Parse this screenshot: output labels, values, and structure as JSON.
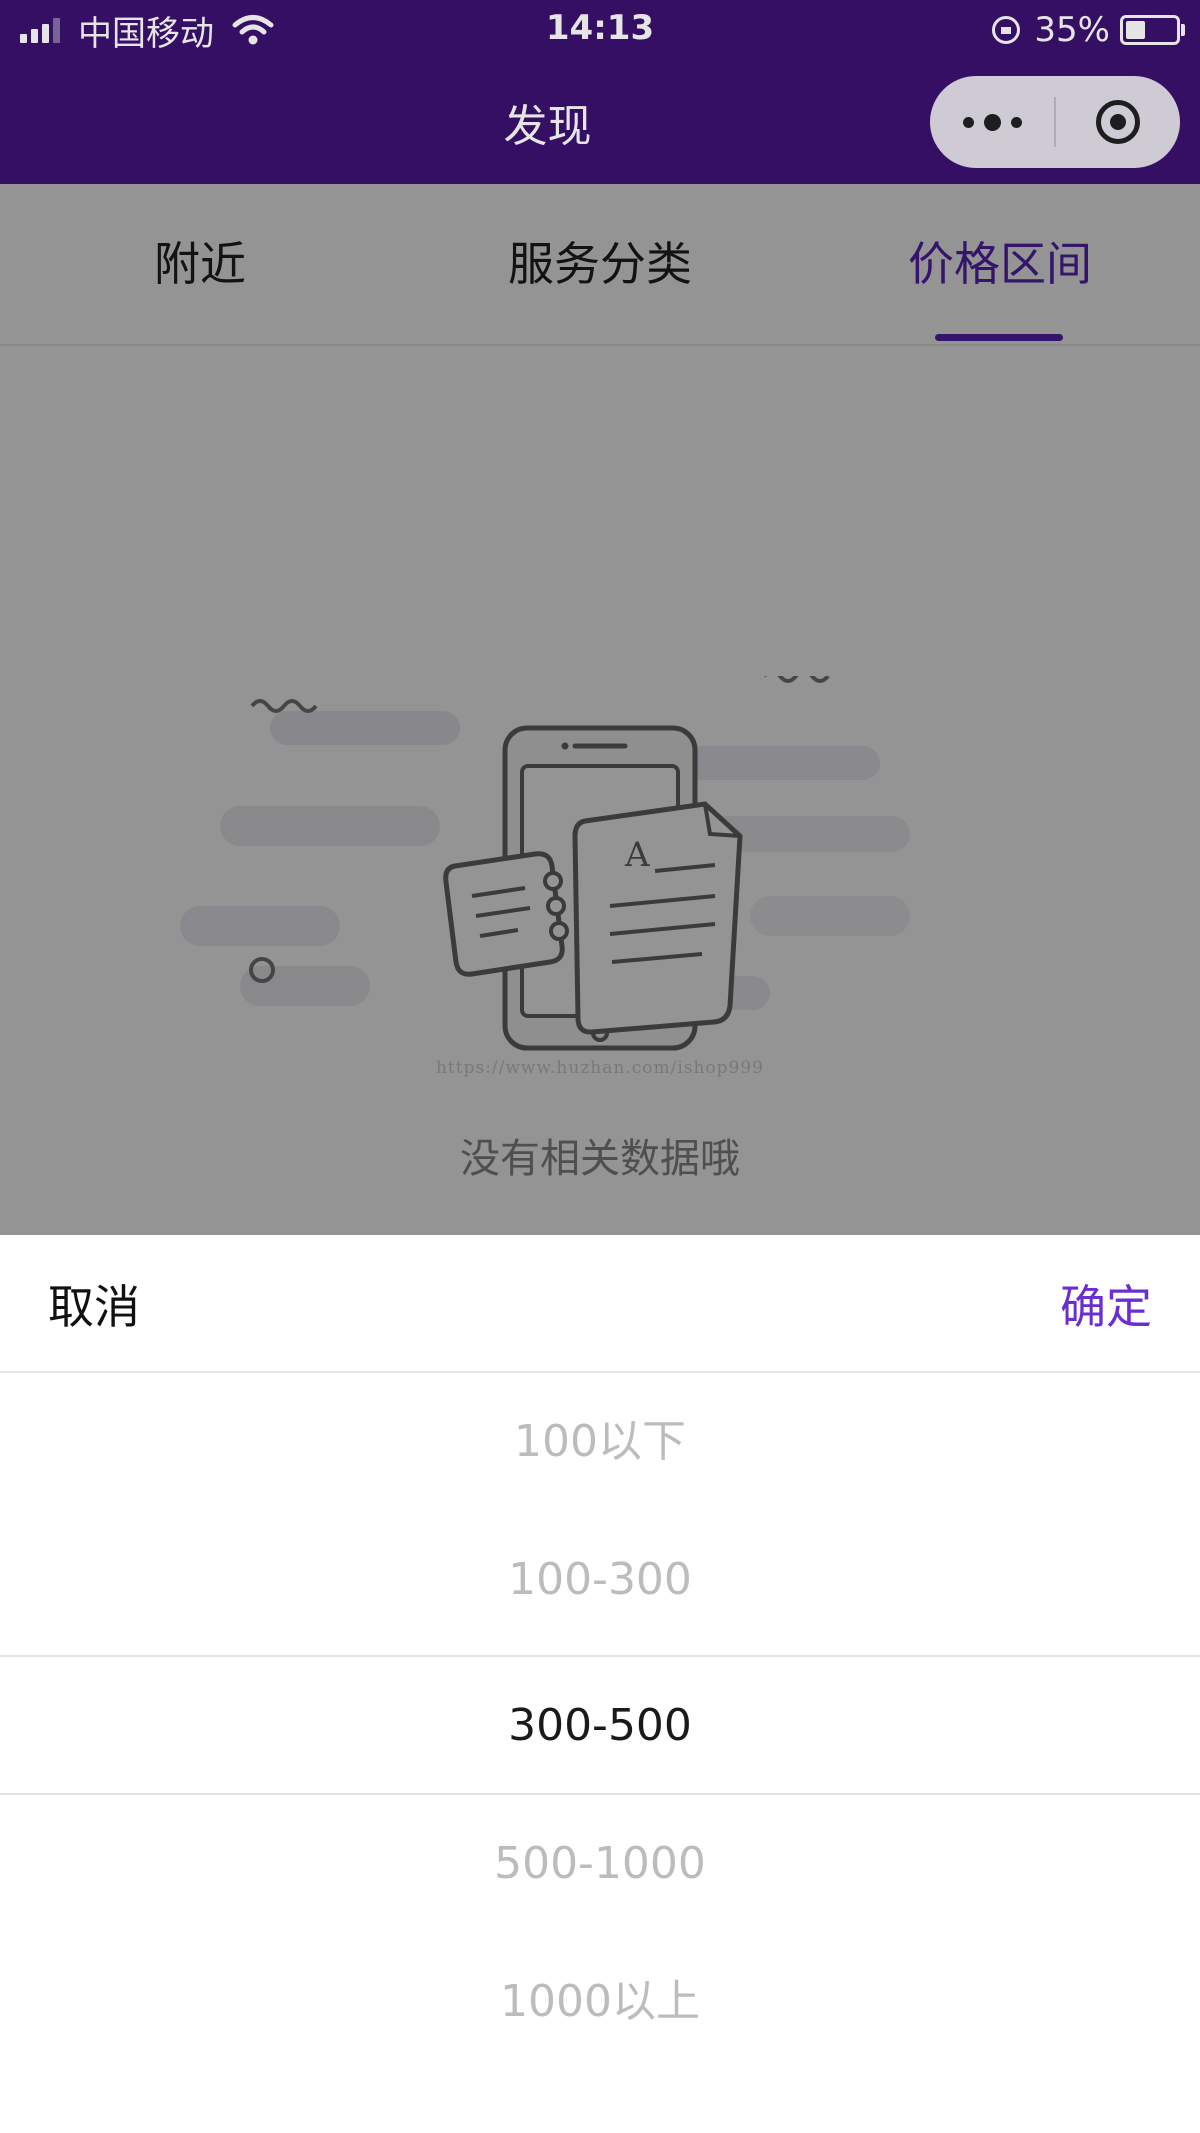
{
  "status_bar": {
    "carrier": "中国移动",
    "time": "14:13",
    "battery": "35%",
    "battery_level": 0.35,
    "icons": [
      "signal-icon",
      "wifi-icon",
      "orientation-lock-icon",
      "battery-icon"
    ]
  },
  "title_bar": {
    "title": "发现",
    "capsule_icons": [
      "more-icon",
      "close-target-icon"
    ],
    "background": "#3a1170"
  },
  "tabs": [
    {
      "label": "附近",
      "active": false
    },
    {
      "label": "服务分类",
      "active": false
    },
    {
      "label": "价格区间",
      "active": true
    }
  ],
  "accent_color": "#5b25b8",
  "content": {
    "empty_message": "没有相关数据哦",
    "watermark": "https://www.huzhan.com/ishop999",
    "empty_icon": "no-data-phone-documents-icon"
  },
  "picker": {
    "cancel_label": "取消",
    "confirm_label": "确定",
    "options": [
      "100以下",
      "100-300",
      "300-500",
      "500-1000",
      "1000以上"
    ],
    "selected_index": 2,
    "selected_value": "300-500"
  }
}
